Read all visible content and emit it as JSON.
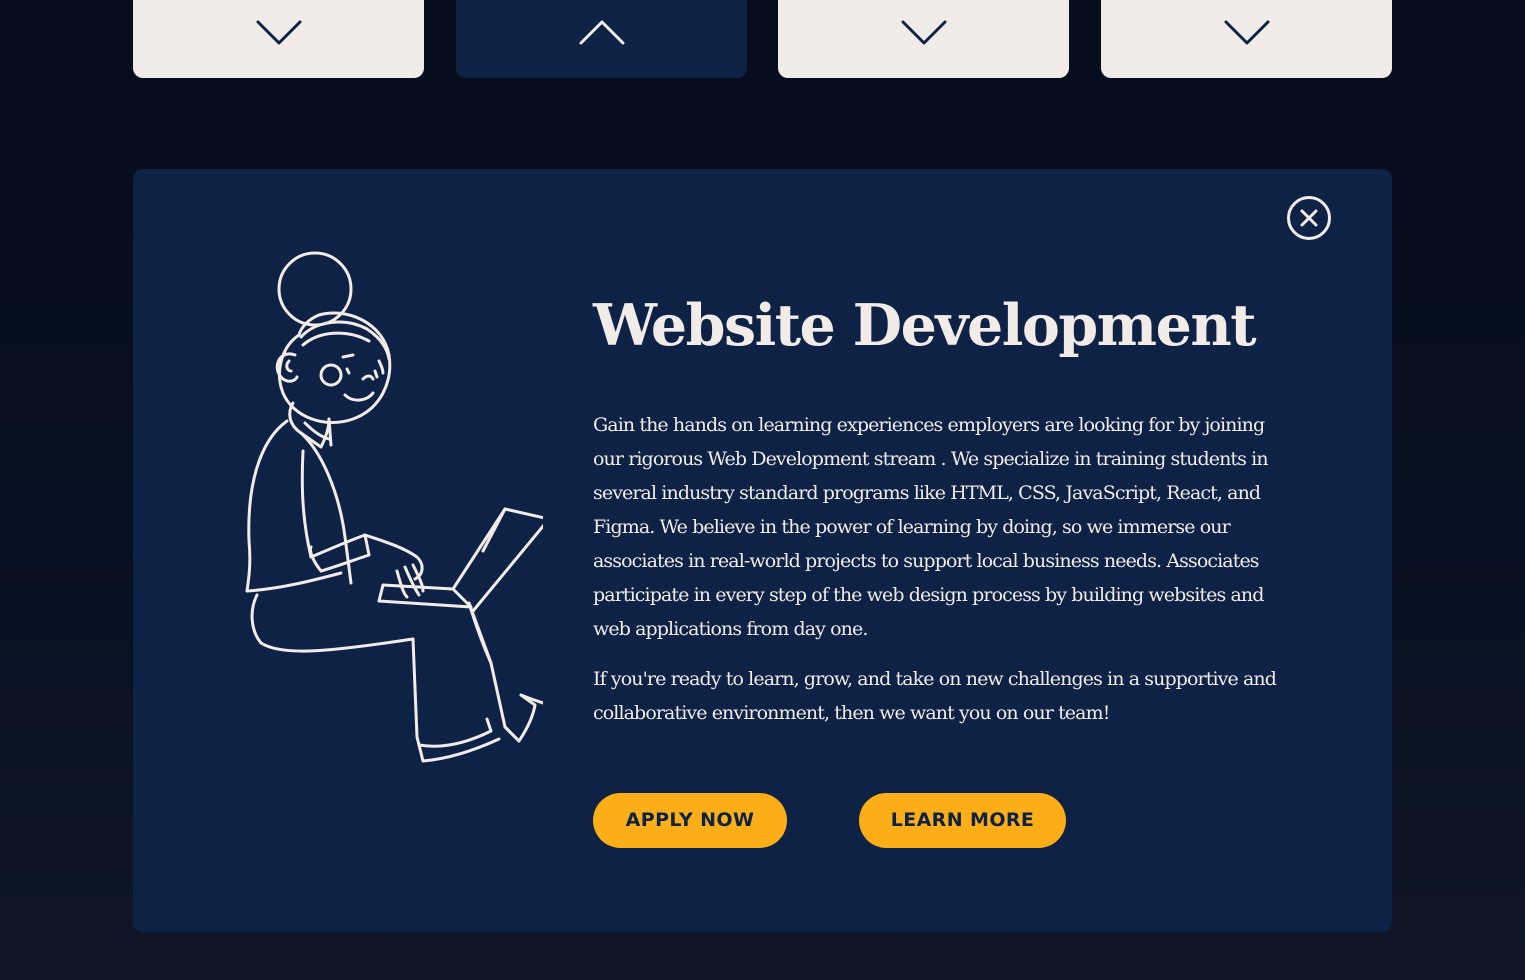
{
  "tabs": [
    {
      "state": "collapsed",
      "icon": "chevron-down-icon"
    },
    {
      "state": "expanded",
      "icon": "chevron-up-icon"
    },
    {
      "state": "collapsed",
      "icon": "chevron-down-icon"
    },
    {
      "state": "collapsed",
      "icon": "chevron-down-icon"
    }
  ],
  "panel": {
    "close_icon": "close-icon",
    "illustration": "person-with-laptop-illustration",
    "title": "Website Development",
    "paragraphs": [
      "Gain the hands on learning experiences employers are looking for by joining our rigorous Web Development stream . We specialize in training students in several industry standard programs like HTML, CSS, JavaScript, React, and Figma. We believe in the power of learning by doing, so we immerse our associates in real-world projects to support local business needs. Associates participate in every step of the web design process by building websites and web applications from day one.",
      "If you're ready to learn, grow, and take on new challenges in a supportive and collaborative environment, then we want you on our team!"
    ],
    "apply_label": "APPLY NOW",
    "learn_label": "LEARN MORE"
  },
  "colors": {
    "background": "#071022",
    "panel": "#0e2245",
    "tab": "#f1ece7",
    "text": "#f1ece7",
    "accent": "#fbae17"
  }
}
